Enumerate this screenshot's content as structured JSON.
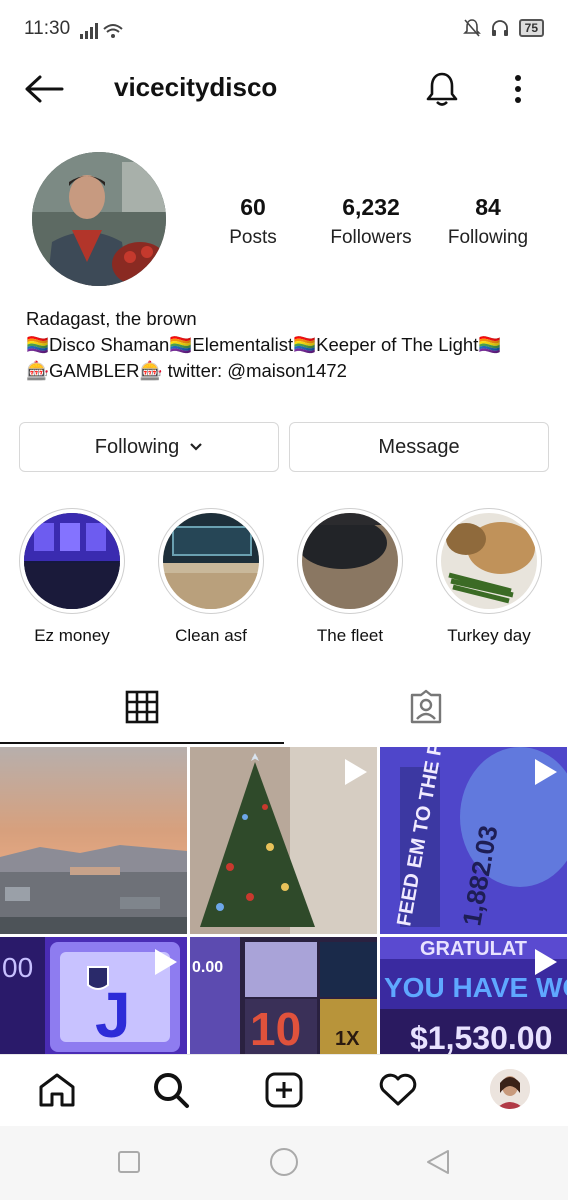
{
  "status_bar": {
    "time": "11:30",
    "battery": "75"
  },
  "header": {
    "username": "vicecitydisco"
  },
  "stats": [
    {
      "value": "60",
      "label": "Posts"
    },
    {
      "value": "6,232",
      "label": "Followers"
    },
    {
      "value": "84",
      "label": "Following"
    }
  ],
  "bio": {
    "name": "Radagast, the brown",
    "line2": "🏳️‍🌈Disco Shaman🏳️‍🌈Elementalist🏳️‍🌈Keeper of The Light🏳️‍🌈",
    "line3": "🎰GAMBLER🎰  twitter: @maison1472"
  },
  "buttons": {
    "following": "Following",
    "message": "Message"
  },
  "highlights": [
    {
      "label": "Ez money"
    },
    {
      "label": "Clean asf"
    },
    {
      "label": "The fleet"
    },
    {
      "label": "Turkey day"
    }
  ],
  "grid_text": {
    "cell3a": "FEED EM TO THE PIGS",
    "cell3b": "1,882.03",
    "cell4": "J",
    "cell4b": "00",
    "cell5a": "10",
    "cell5b": "1X",
    "cell5c": "0.00",
    "cell6a": "YOU HAVE WO",
    "cell6b": "$1,530.00",
    "cell6c": "GRATULAT"
  },
  "icons": {
    "back": "back-arrow-icon",
    "bell": "notification-bell-icon",
    "more": "more-options-icon",
    "grid": "grid-tab-icon",
    "tagged": "tagged-tab-icon",
    "home": "home-icon",
    "search": "search-icon",
    "add": "add-post-icon",
    "heart": "activity-heart-icon"
  }
}
